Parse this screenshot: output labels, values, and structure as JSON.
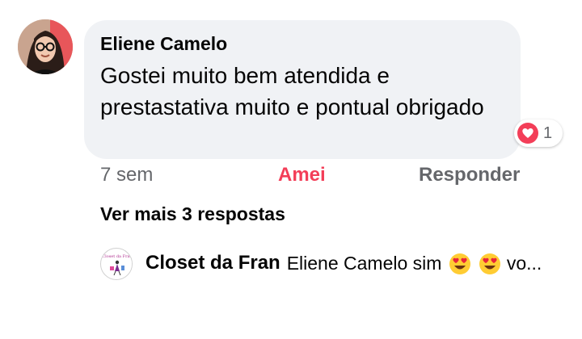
{
  "comment": {
    "author": "Eliene Camelo",
    "text": "Gostei muito bem atendida e prestastativa muito e pontual obrigado",
    "reaction_count": "1",
    "reaction_icon": "heart-love-icon",
    "time": "7 sem",
    "like_label": "Amei",
    "reply_label": "Responder"
  },
  "replies": {
    "more_label": "Ver mais 3 respostas",
    "preview_author": "Closet da Fran",
    "preview_text": "Eliene Camelo sim",
    "preview_ellipsis": "vo...",
    "preview_logo_text": "Closet da Fran"
  },
  "colors": {
    "accent_love": "#f33e58",
    "bubble_bg": "#f0f2f5",
    "muted_text": "#65676b"
  }
}
